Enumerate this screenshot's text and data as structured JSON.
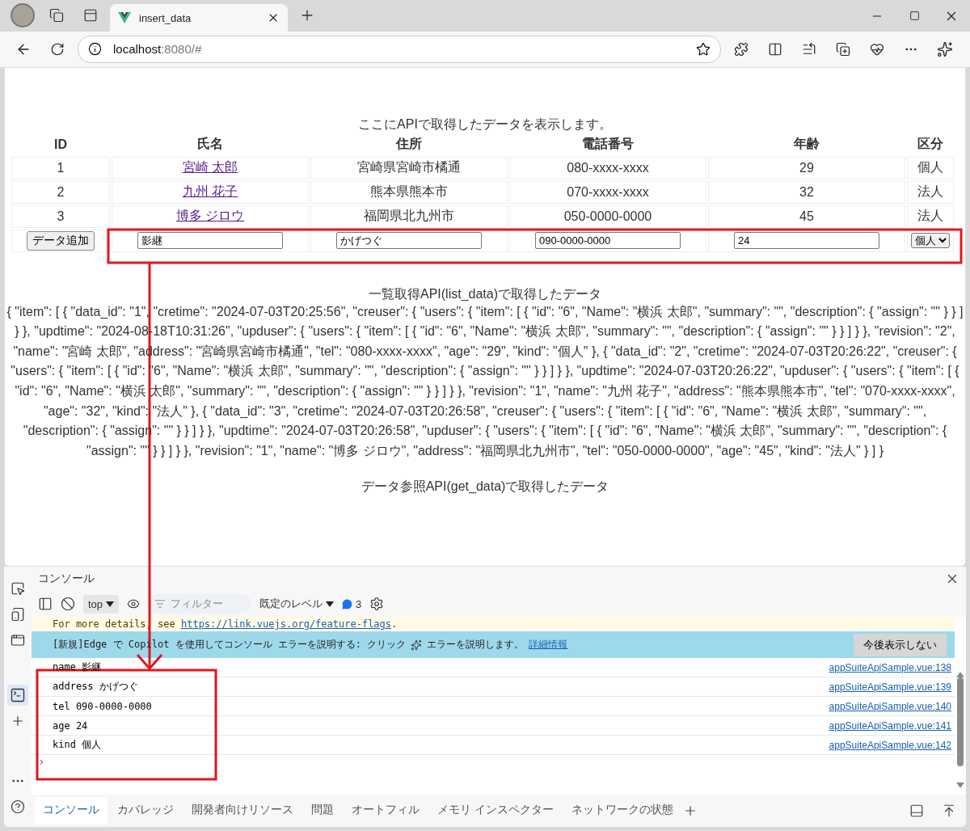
{
  "browser": {
    "tab_title": "insert_data",
    "url_host": "localhost",
    "url_rest": ":8080/#"
  },
  "page": {
    "heading": "ここにAPIで取得したデータを表示します。",
    "table": {
      "columns": [
        "ID",
        "氏名",
        "住所",
        "電話番号",
        "年齢",
        "区分"
      ],
      "rows": [
        {
          "id": "1",
          "name": "宮崎 太郎",
          "address": "宮崎県宮崎市橘通",
          "tel": "080-xxxx-xxxx",
          "age": "29",
          "kind": "個人"
        },
        {
          "id": "2",
          "name": "九州 花子",
          "address": "熊本県熊本市",
          "tel": "070-xxxx-xxxx",
          "age": "32",
          "kind": "法人"
        },
        {
          "id": "3",
          "name": "博多 ジロウ",
          "address": "福岡県北九州市",
          "tel": "050-0000-0000",
          "age": "45",
          "kind": "法人"
        }
      ],
      "input_row": {
        "button": "データ追加",
        "name": "影継",
        "address": "かげつぐ",
        "tel": "090-0000-0000",
        "age": "24",
        "kind": "個人"
      }
    },
    "list_heading": "一覧取得API(list_data)で取得したデータ",
    "list_json": "{ \"item\": [ { \"data_id\": \"1\", \"cretime\": \"2024-07-03T20:25:56\", \"creuser\": { \"users\": { \"item\": [ { \"id\": \"6\", \"Name\": \"横浜 太郎\", \"summary\": \"\", \"description\": { \"assign\": \"\" } } ] } }, \"updtime\": \"2024-08-18T10:31:26\", \"upduser\": { \"users\": { \"item\": [ { \"id\": \"6\", \"Name\": \"横浜 太郎\", \"summary\": \"\", \"description\": { \"assign\": \"\" } } ] } }, \"revision\": \"2\", \"name\": \"宮崎 太郎\", \"address\": \"宮崎県宮崎市橘通\", \"tel\": \"080-xxxx-xxxx\", \"age\": \"29\", \"kind\": \"個人\" }, { \"data_id\": \"2\", \"cretime\": \"2024-07-03T20:26:22\", \"creuser\": { \"users\": { \"item\": [ { \"id\": \"6\", \"Name\": \"横浜 太郎\", \"summary\": \"\", \"description\": { \"assign\": \"\" } } ] } }, \"updtime\": \"2024-07-03T20:26:22\", \"upduser\": { \"users\": { \"item\": [ { \"id\": \"6\", \"Name\": \"横浜 太郎\", \"summary\": \"\", \"description\": { \"assign\": \"\" } } ] } }, \"revision\": \"1\", \"name\": \"九州 花子\", \"address\": \"熊本県熊本市\", \"tel\": \"070-xxxx-xxxx\", \"age\": \"32\", \"kind\": \"法人\" }, { \"data_id\": \"3\", \"cretime\": \"2024-07-03T20:26:58\", \"creuser\": { \"users\": { \"item\": [ { \"id\": \"6\", \"Name\": \"横浜 太郎\", \"summary\": \"\", \"description\": { \"assign\": \"\" } } ] } }, \"updtime\": \"2024-07-03T20:26:58\", \"upduser\": { \"users\": { \"item\": [ { \"id\": \"6\", \"Name\": \"横浜 太郎\", \"summary\": \"\", \"description\": { \"assign\": \"\" } } ] } }, \"revision\": \"1\", \"name\": \"博多 ジロウ\", \"address\": \"福岡県北九州市\", \"tel\": \"050-0000-0000\", \"age\": \"45\", \"kind\": \"法人\" } ] }",
    "get_heading": "データ参照API(get_data)で取得したデータ"
  },
  "devtools": {
    "panel_title": "コンソール",
    "toolbar": {
      "context": "top",
      "filter_placeholder": "フィルター",
      "levels": "既定のレベル",
      "message_count": "3"
    },
    "warning": {
      "text": "For more details, see ",
      "link": "https://link.vuejs.org/feature-flags",
      "end": "."
    },
    "banner": {
      "text": "[新規]Edge で Copilot を使用してコンソール エラーを説明する: クリック",
      "text2": "エラーを説明します。",
      "link": "詳細情報",
      "button": "今後表示しない"
    },
    "logs": [
      {
        "message": "name 影継",
        "source": "appSuiteApiSample.vue:138"
      },
      {
        "message": "address かげつぐ",
        "source": "appSuiteApiSample.vue:139"
      },
      {
        "message": "tel 090-0000-0000",
        "source": "appSuiteApiSample.vue:140"
      },
      {
        "message": "age 24",
        "source": "appSuiteApiSample.vue:141"
      },
      {
        "message": "kind 個人",
        "source": "appSuiteApiSample.vue:142"
      }
    ],
    "prompt": "›",
    "tabs": [
      {
        "label": "コンソール",
        "selected": true
      },
      {
        "label": "カバレッジ",
        "selected": false
      },
      {
        "label": "開発者向けリソース",
        "selected": false
      },
      {
        "label": "問題",
        "selected": false
      },
      {
        "label": "オートフィル",
        "selected": false
      },
      {
        "label": "メモリ インスペクター",
        "selected": false
      },
      {
        "label": "ネットワークの状態",
        "selected": false
      }
    ]
  }
}
